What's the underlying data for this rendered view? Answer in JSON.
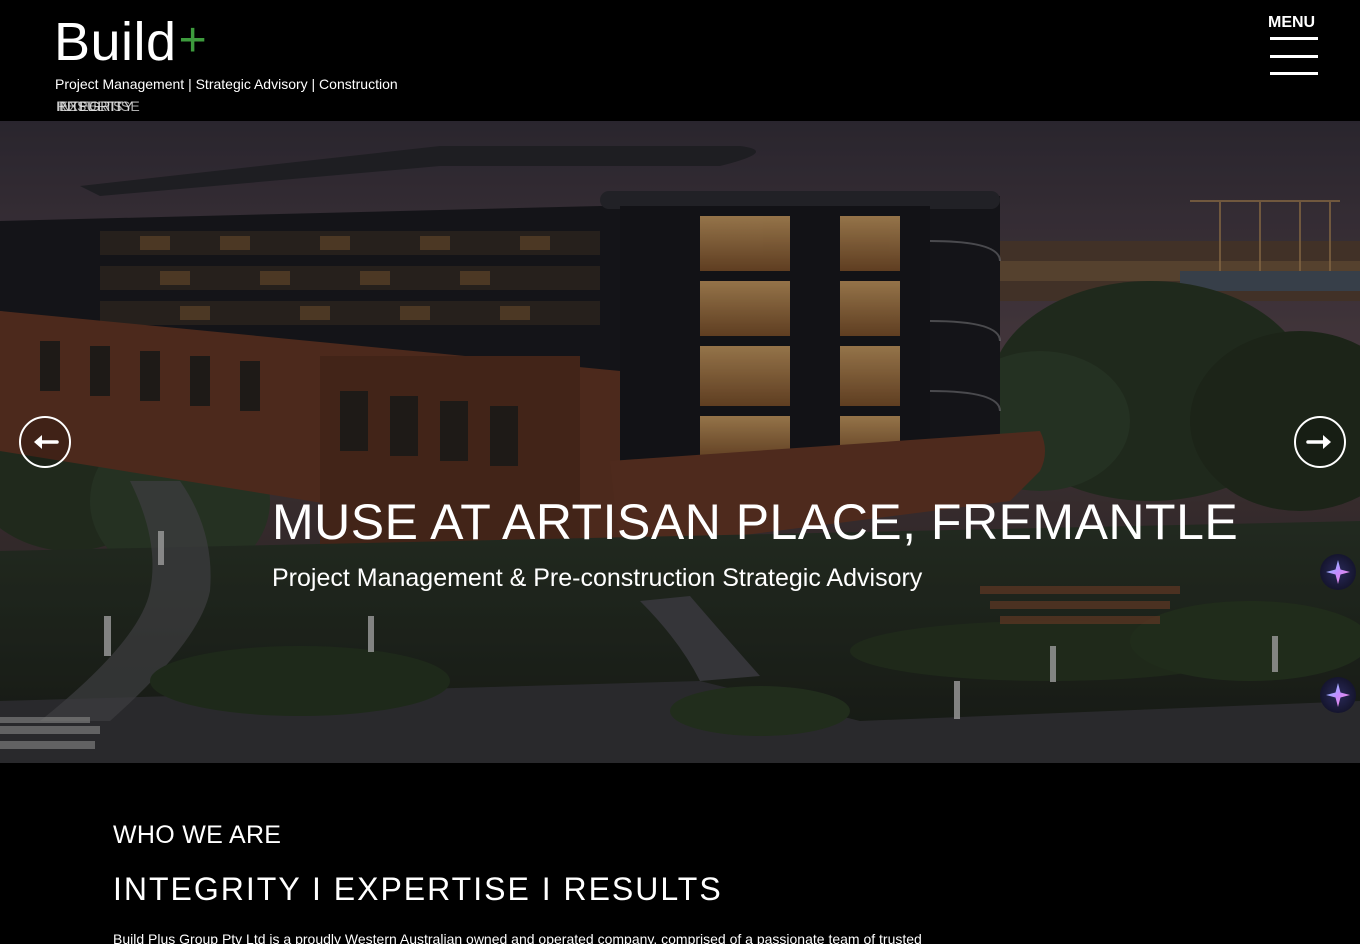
{
  "header": {
    "logo_word": "Build",
    "logo_plus": "+",
    "tagline": "Project Management | Strategic Advisory | Construction",
    "rotating_words": [
      "INTEGRITY",
      "RESULTS",
      "EXPERTISE"
    ],
    "menu_label": "MENU"
  },
  "hero": {
    "title": "MUSE AT ARTISAN PLACE, FREMANTLE",
    "subtitle": "Project Management & Pre-construction Strategic Advisory",
    "prev_icon": "arrow-left-icon",
    "next_icon": "arrow-right-icon"
  },
  "about": {
    "kicker": "WHO WE ARE",
    "values": "INTEGRITY I EXPERTISE I RESULTS",
    "paragraph": "Build Plus Group Pty Ltd is a proudly Western Australian owned and operated company, comprised of a passionate team of trusted"
  },
  "colors": {
    "background": "#000000",
    "text": "#ffffff",
    "brand_plus": "#3d9b3d"
  }
}
